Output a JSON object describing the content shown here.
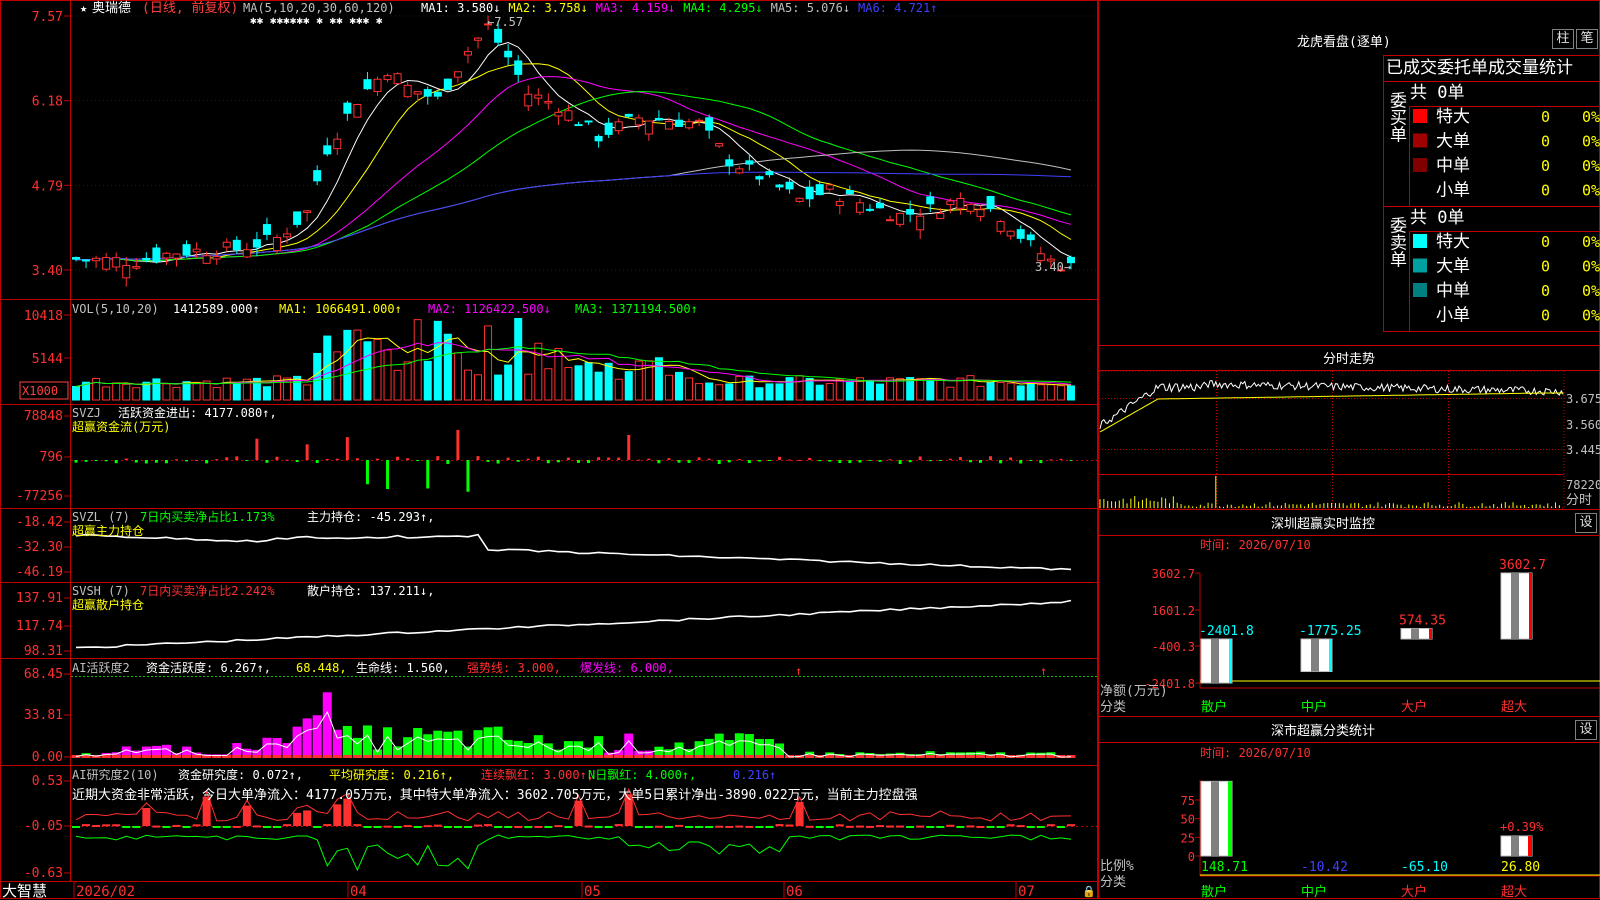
{
  "stock": {
    "name": "奥瑞德",
    "mode": "(日线, 前复权)"
  },
  "price_panel": {
    "ma_params": "MA(5,10,20,30,60,120)",
    "ma_labels": [
      {
        "text": "MA1: 3.580↓",
        "color": "#ffffff"
      },
      {
        "text": "MA2: 3.758↓",
        "color": "#ffff00"
      },
      {
        "text": "MA3: 4.159↓",
        "color": "#ff00ff"
      },
      {
        "text": "MA4: 4.295↓",
        "color": "#00ff00"
      },
      {
        "text": "MA5: 5.076↓",
        "color": "#c0c0c0"
      },
      {
        "text": "MA6: 4.721↑",
        "color": "#4040ff"
      }
    ],
    "yticks": [
      "7.57",
      "6.18",
      "4.79",
      "3.40"
    ],
    "high_label": "7.57",
    "low_label": "3.40→",
    "markers": "✱✱  ✱✱✱✱✱✱   ✱     ✱✱  ✱✱✱ ✱"
  },
  "vol_panel": {
    "params": "VOL(5,10,20)",
    "value": "1412589.000↑",
    "ma1": "MA1: 1066491.000↑",
    "ma2": "MA2: 1126422.500↓",
    "ma3": "MA3: 1371194.500↑",
    "yticks": [
      "10418",
      "5144"
    ],
    "unit": "X1000"
  },
  "svzj_panel": {
    "name": "SVZJ",
    "label": "活跃资金进出: 4177.080↑,",
    "subtitle": "超赢资金流(万元)",
    "yticks": [
      "78848",
      "796",
      "-77256"
    ]
  },
  "svzl_panel": {
    "name": "SVZL (7)",
    "label1": "7日内买卖净占比1.173%",
    "label2": "主力持仓: -45.293↑,",
    "subtitle": "超赢主力持仓",
    "yticks": [
      "-18.42",
      "-32.30",
      "-46.19"
    ]
  },
  "svsh_panel": {
    "name": "SVSH (7)",
    "label1": "7日内买卖净占比2.242%",
    "label2": "散户持仓: 137.211↓,",
    "subtitle": "超赢散户持仓",
    "yticks": [
      "137.91",
      "117.74",
      "98.31"
    ]
  },
  "ai_panel": {
    "name": "AI活跃度2",
    "l1": "资金活跃度: 6.267↑,",
    "l2": "68.448,",
    "l3": "生命线: 1.560,",
    "l4": "强势线: 3.000,",
    "l5": "爆发线: 6.000,",
    "yticks": [
      "68.45",
      "33.81",
      "0.00"
    ]
  },
  "research_panel": {
    "name": "AI研究度2(10)",
    "l1": "资金研究度: 0.072↑,",
    "l2": "平均研究度: 0.216↑,",
    "l3": "连续飘红: 3.000↑,",
    "l4": "N日飘红: 4.000↑,",
    "l5": "0.216↑",
    "text": "近期大资金非常活跃，今日大单净流入：4177.05万元，其中特大单净流入：3602.705万元，大单5日累计净出-3890.022万元，当前主力控盘强",
    "yticks": [
      "0.53",
      "-0.05",
      "-0.63"
    ]
  },
  "bottom_axis": {
    "brand": "大智慧",
    "months": [
      "2026/02",
      "04",
      "05",
      "06",
      "07"
    ]
  },
  "lhb": {
    "title": "龙虎看盘(逐单)",
    "btn1": "柱",
    "btn2": "笔",
    "header": "已成交委托单成交量统计",
    "buy_label": "委买单",
    "sell_label": "委卖单",
    "buy_total": "共 0单",
    "sell_total": "共 0单",
    "rows": [
      {
        "name": "特大",
        "val": "0",
        "pct": "0%"
      },
      {
        "name": "大单",
        "val": "0",
        "pct": "0%"
      },
      {
        "name": "中单",
        "val": "0",
        "pct": "0%"
      },
      {
        "name": "小单",
        "val": "0",
        "pct": "0%"
      }
    ],
    "buy_colors": [
      "#ff0000",
      "#a00000",
      "#800000",
      "#000000"
    ],
    "sell_colors": [
      "#00ffff",
      "#00a0a0",
      "#008080",
      "#000000"
    ]
  },
  "fenshi": {
    "title": "分时走势",
    "yticks": [
      "3.675",
      "3.560",
      "3.445"
    ],
    "vol_label": "78220",
    "bottom_label": "分时"
  },
  "monitor": {
    "title": "深圳超赢实时监控",
    "btn": "设",
    "time": "时间: 2026/07/10",
    "yticks": [
      "3602.7",
      "1601.2",
      "-400.3",
      "-2401.8"
    ],
    "axis_label1": "净额(万元)",
    "axis_label2": "分类",
    "chart_data": {
      "type": "bar",
      "categories": [
        "散户",
        "中户",
        "大户",
        "超大"
      ],
      "values": [
        -2401.8,
        -1775.25,
        574.35,
        3602.7
      ],
      "value_labels": [
        "-2401.8",
        "-1775.25",
        "574.35",
        "3602.7"
      ],
      "ylabel": "净额(万元)",
      "xlabel": "分类",
      "ylim": [
        -2401.8,
        3602.7
      ]
    }
  },
  "classify": {
    "title": "深市超赢分类统计",
    "btn": "设",
    "time": "时间: 2026/07/10",
    "yticks": [
      "75",
      "50",
      "25",
      "0"
    ],
    "axis_label1": "比例%",
    "axis_label2": "分类",
    "extra_label": "+0.39%",
    "chart_data": {
      "type": "bar",
      "categories": [
        "散户",
        "中户",
        "大户",
        "超大"
      ],
      "values": [
        148.71,
        -10.42,
        -65.1,
        26.8
      ],
      "value_labels": [
        "148.71",
        "-10.42",
        "-65.10",
        "26.80"
      ],
      "ylabel": "比例%",
      "xlabel": "分类",
      "ylim": [
        0,
        75
      ]
    }
  }
}
